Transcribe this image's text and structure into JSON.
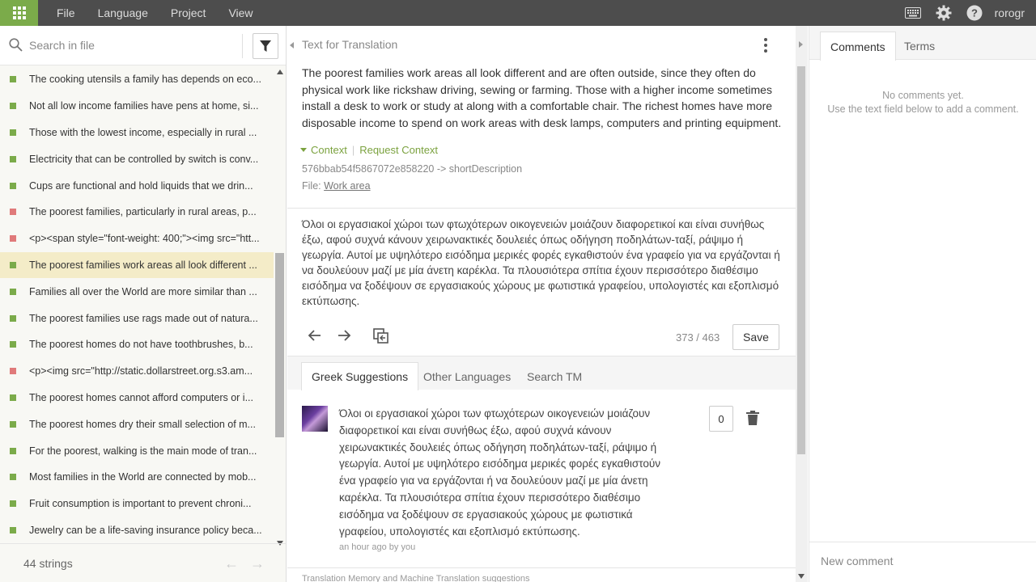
{
  "topbar": {
    "menu": [
      "File",
      "Language",
      "Project",
      "View"
    ],
    "username": "rorogr",
    "icons": [
      "apps-grid-icon",
      "keyboard-icon",
      "gear-icon",
      "help-icon"
    ],
    "accent": "#7bab4a"
  },
  "sidebar": {
    "search_placeholder": "Search in file",
    "count_label": "44 strings",
    "items": [
      {
        "text": "The cooking utensils a family has depends on eco...",
        "status": "translated"
      },
      {
        "text": "Not all low income families have pens at home, si...",
        "status": "translated"
      },
      {
        "text": "Those with the lowest income, especially in rural ...",
        "status": "translated"
      },
      {
        "text": "Electricity that can be controlled by switch is conv...",
        "status": "translated"
      },
      {
        "text": "Cups are functional and hold liquids that we drin...",
        "status": "translated"
      },
      {
        "text": "The poorest families, particularly in rural areas, p...",
        "status": "untranslated"
      },
      {
        "text": "<p><span style=\"font-weight: 400;\"><img src=\"htt...",
        "status": "untranslated"
      },
      {
        "text": "The poorest families work areas all look different ...",
        "status": "translated"
      },
      {
        "text": "Families all over the World are more similar than ...",
        "status": "translated"
      },
      {
        "text": "The poorest families use rags made out of natura...",
        "status": "translated"
      },
      {
        "text": "The poorest homes do not have toothbrushes, b...",
        "status": "translated"
      },
      {
        "text": "<p><img src=\"http://static.dollarstreet.org.s3.am...",
        "status": "untranslated"
      },
      {
        "text": "The poorest homes cannot afford computers or i...",
        "status": "translated"
      },
      {
        "text": "The poorest homes dry their small selection of m...",
        "status": "translated"
      },
      {
        "text": "For the poorest, walking is the main mode of tran...",
        "status": "translated"
      },
      {
        "text": "Most families in the World are connected by mob...",
        "status": "translated"
      },
      {
        "text": "Fruit consumption is important to prevent chroni...",
        "status": "translated"
      },
      {
        "text": "Jewelry can be a life-saving insurance policy beca...",
        "status": "translated"
      }
    ],
    "status_colors": {
      "translated": "#7bab4a",
      "untranslated": "#e07a7a"
    }
  },
  "editor": {
    "header": "Text for Translation",
    "source_text": "The poorest families work areas all look different and are often outside, since they often do physical work like rickshaw driving, sewing or farming. Those with a higher income sometimes install a desk to work or study at along with a comfortable chair. The richest homes have more disposable income to spend on work areas with desk lamps, computers and printing equipment.",
    "context_label": "Context",
    "request_context_label": "Request Context",
    "context_key": "576bbab54f5867072e858220 -> shortDescription",
    "file_label": "File:",
    "file_name": "Work area",
    "translation": "Όλοι οι εργασιακοί χώροι των φτωχότερων οικογενειών μοιάζουν διαφορετικοί και είναι συνήθως έξω, αφού συχνά κάνουν χειρωνακτικές δουλειές όπως οδήγηση ποδηλάτων-ταξί, ράψιμο ή γεωργία. Αυτοί με υψηλότερο εισόδημα μερικές φορές εγκαθιστούν ένα γραφείο για να εργάζονται ή να δουλεύουν μαζί με μία άνετη καρέκλα. Τα πλουσιότερα σπίτια έχουν περισσότερο διαθέσιμο εισόδημα να ξοδέψουν σε εργασιακούς χώρους με φωτιστικά γραφείου, υπολογιστές και εξοπλισμό εκτύπωσης.",
    "char_count": "373 / 463",
    "save_label": "Save"
  },
  "suggestions": {
    "tabs": [
      "Greek Suggestions",
      "Other Languages",
      "Search TM"
    ],
    "items": [
      {
        "text": "Όλοι οι εργασιακοί χώροι των φτωχότερων οικογενειών μοιάζουν διαφορετικοί και είναι συνήθως έξω, αφού συχνά κάνουν χειρωνακτικές δουλειές όπως οδήγηση ποδηλάτων-ταξί, ράψιμο ή γεωργία. Αυτοί με υψηλότερο εισόδημα μερικές φορές εγκαθιστούν ένα γραφείο για να εργάζονται ή να δουλεύουν μαζί με μία άνετη καρέκλα. Τα πλουσιότερα σπίτια έχουν περισσότερο διαθέσιμο εισόδημα να ξοδέψουν σε εργασιακούς χώρους με φωτιστικά γραφείου, υπολογιστές και εξοπλισμό εκτύπωσης.",
        "meta": "an hour ago by you",
        "votes": "0"
      }
    ],
    "footer": "Translation Memory and Machine Translation suggestions"
  },
  "comments": {
    "tabs": [
      "Comments",
      "Terms"
    ],
    "empty_line1": "No comments yet.",
    "empty_line2": "Use the text field below to add a comment.",
    "new_comment_placeholder": "New comment"
  }
}
